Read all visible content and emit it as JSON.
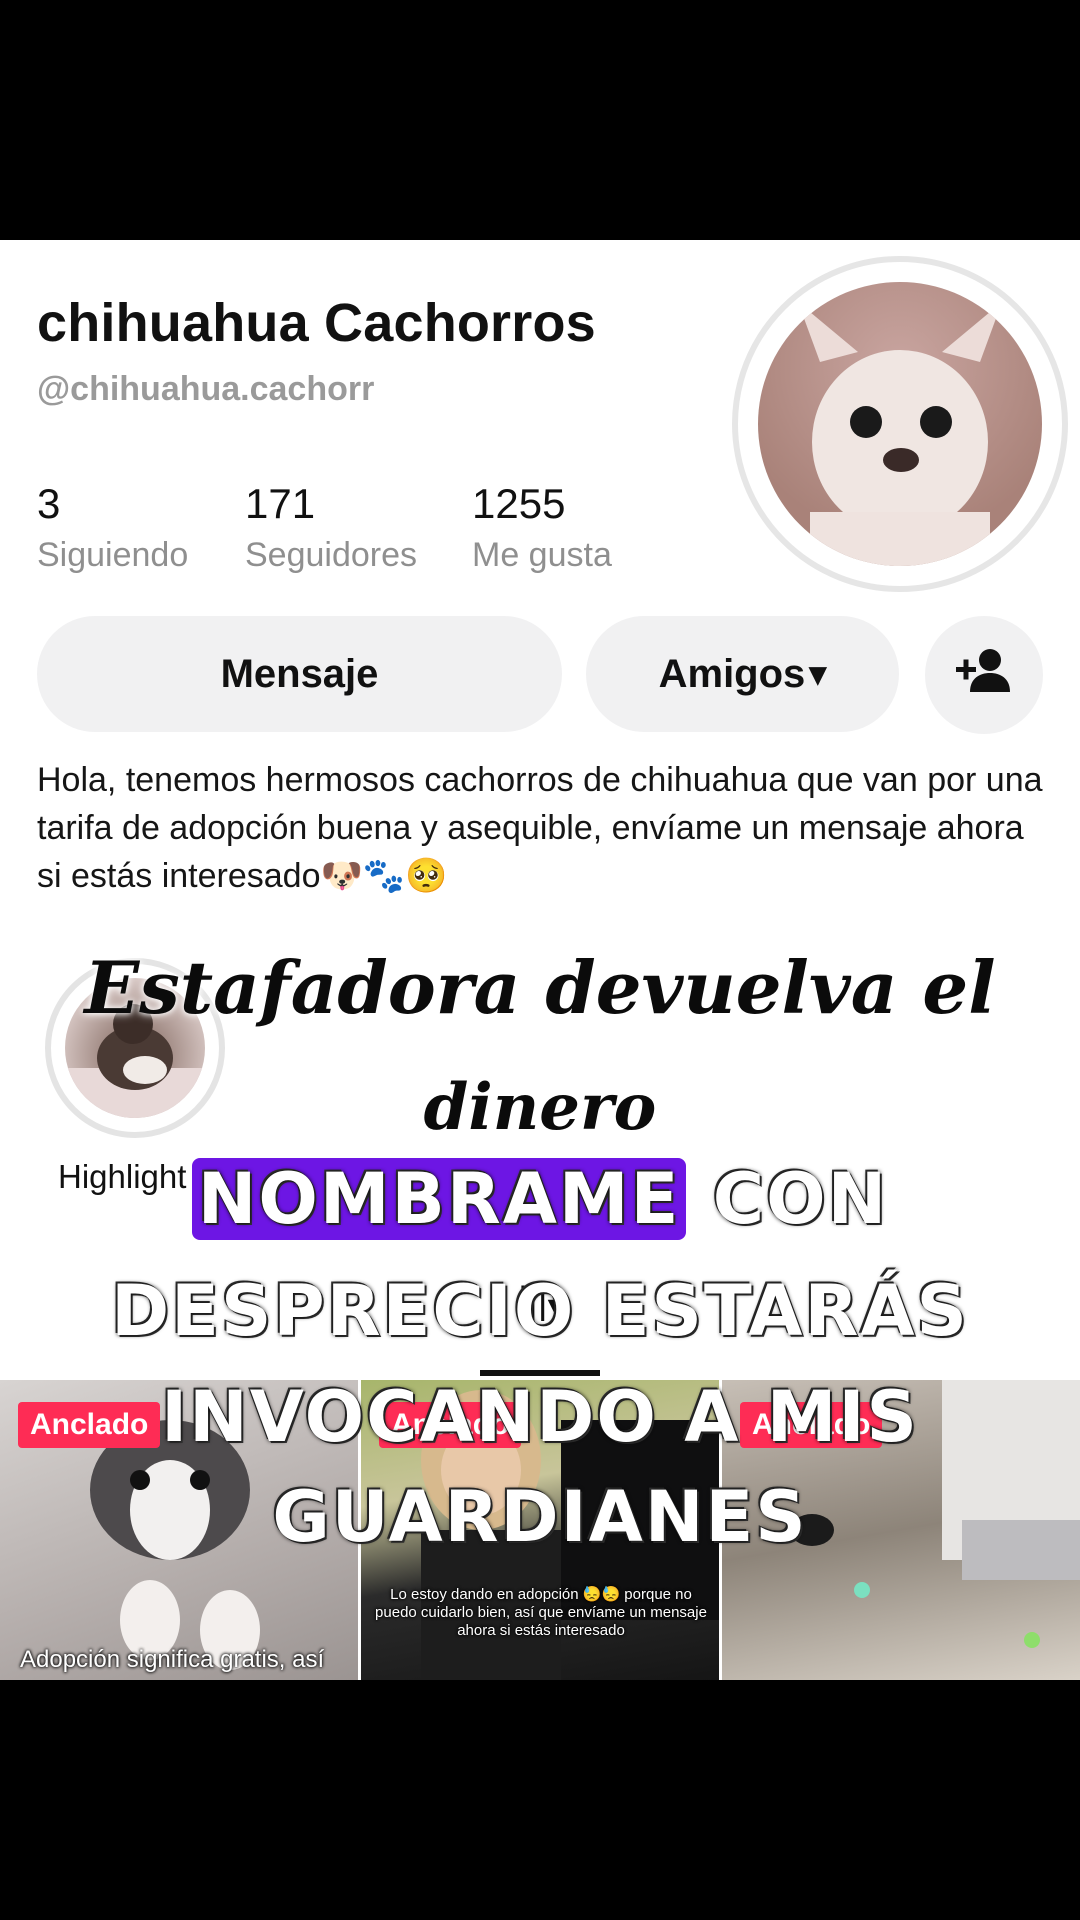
{
  "profile": {
    "name": "chihuahua Cachorros",
    "handle": "@chihuahua.cachorr",
    "stats": [
      {
        "value": "3",
        "label": "Siguiendo"
      },
      {
        "value": "171",
        "label": "Seguidores"
      },
      {
        "value": "1255",
        "label": "Me gusta"
      }
    ],
    "buttons": {
      "message": "Mensaje",
      "friends": "Amigos",
      "friends_caret": "▾",
      "add_friend_icon": "person-plus-icon"
    },
    "bio": "Hola, tenemos hermosos cachorros de chihuahua que van por una tarifa de adopción buena y asequible, envíame un mensaje ahora si estás interesado🐶🐾🥺",
    "highlight_label": "Highlight"
  },
  "tabs": {
    "icon": "|||",
    "caret": "▾"
  },
  "videos": [
    {
      "pinned": "Anclado",
      "caption": "Adopción significa gratis, así"
    },
    {
      "pinned": "Anclado",
      "caption": "Lo estoy dando en adopción 😓😓 porque no puedo cuidarlo bien, así que envíame un mensaje ahora si estás interesado"
    },
    {
      "pinned": "Anclado",
      "caption": ""
    }
  ],
  "overlay": {
    "title_line1": "Estafadora devuelva el",
    "title_line2": "dinero",
    "caption_highlight": "NOMBRAME",
    "caption_rest1": " CON",
    "caption_line2": "DESPRECIO ESTARÁS",
    "caption_line3": "INVOCANDO A MIS",
    "caption_line4": "GUARDIANES"
  },
  "colors": {
    "pin": "#fe2c55",
    "highlight": "#6d16e4",
    "button_bg": "#f1f1f2"
  }
}
